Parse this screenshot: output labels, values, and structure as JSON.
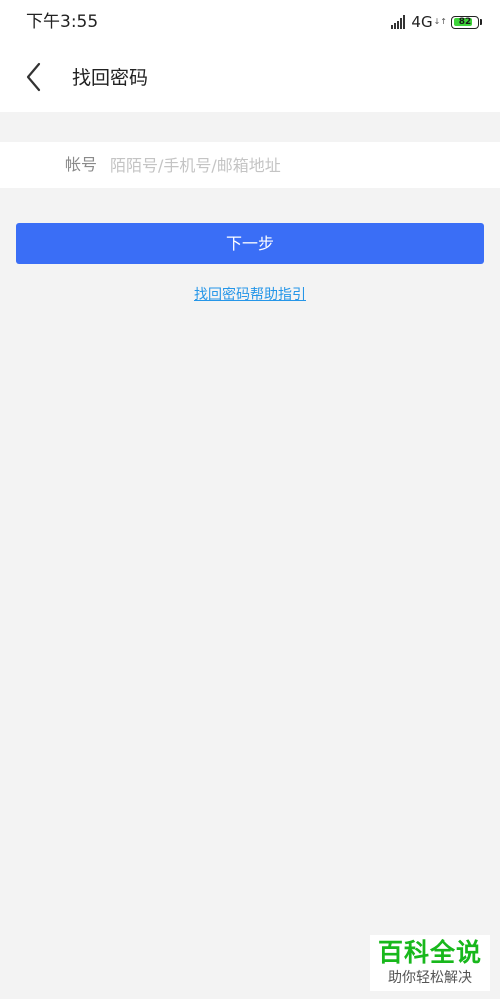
{
  "status_bar": {
    "time": "下午3:55",
    "network": "4G",
    "network_arrows": "↓↑",
    "battery_level": "82",
    "battery_fraction": 0.82,
    "battery_color": "#3ed43a"
  },
  "header": {
    "title": "找回密码",
    "back_icon": "chevron-left-icon"
  },
  "form": {
    "account_label": "帐号",
    "account_value": "",
    "account_placeholder": "陌陌号/手机号/邮箱地址"
  },
  "actions": {
    "next_label": "下一步",
    "next_color": "#3a6ef6",
    "help_link": "找回密码帮助指引",
    "help_link_color": "#2596e8"
  },
  "watermark": {
    "title": "百科全说",
    "subtitle": "助你轻松解决"
  }
}
